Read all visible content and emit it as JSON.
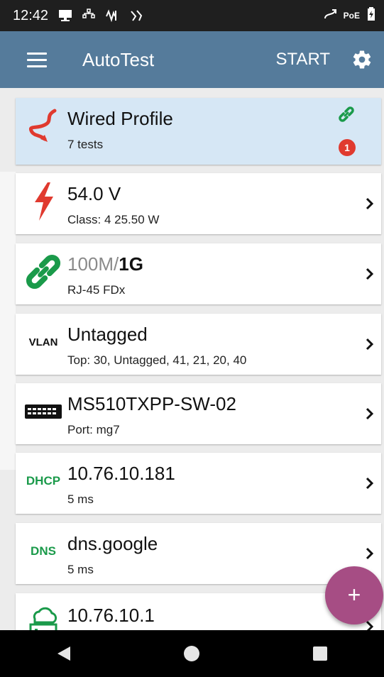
{
  "statusbar": {
    "time": "12:42",
    "poe_label": "PoE"
  },
  "appbar": {
    "title": "AutoTest",
    "start_label": "START"
  },
  "profile": {
    "title": "Wired Profile",
    "subtitle": "7 tests",
    "badge_count": "1"
  },
  "poe": {
    "title": "54.0 V",
    "subtitle": "Class:  4    25.50 W"
  },
  "link": {
    "title_muted": "100M/",
    "title_bold": "1G",
    "subtitle": "RJ-45    FDx"
  },
  "vlan": {
    "icon_text": "VLAN",
    "title": "Untagged",
    "subtitle": "Top:  30, Untagged, 41, 21, 20, 40"
  },
  "switch": {
    "title": "MS510TXPP-SW-02",
    "subtitle": "Port:  mg7"
  },
  "dhcp": {
    "icon_text": "DHCP",
    "title": "10.76.10.181",
    "subtitle": "5 ms"
  },
  "dns": {
    "icon_text": "DNS",
    "title": "dns.google",
    "subtitle": "5 ms"
  },
  "gateway": {
    "title": "10.76.10.1"
  },
  "fab": {
    "label": "+"
  },
  "colors": {
    "appbar": "#557b9b",
    "profile_bg": "#d6e7f5",
    "green": "#1a9a4a",
    "red": "#e03a2f",
    "fab": "#a64d84"
  }
}
